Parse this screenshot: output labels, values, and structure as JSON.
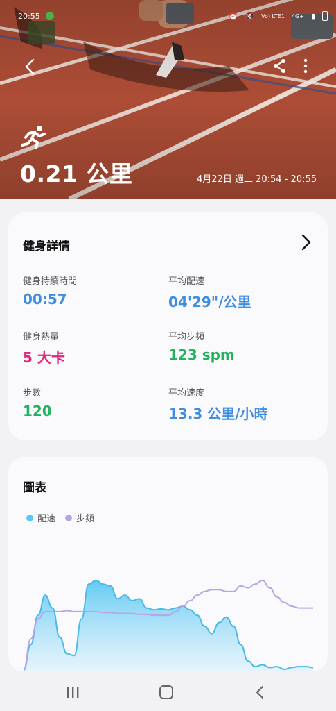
{
  "status_bar": {
    "time": "20:55",
    "signal_text": "Vo) LTE1",
    "network_text": "4G+"
  },
  "hero": {
    "distance": "0.21 公里",
    "datetime": "4月22日 週二 20:54 - 20:55",
    "icons": {
      "back": "back-arrow-icon",
      "share": "share-icon",
      "more": "more-vertical-icon",
      "activity": "running-icon"
    }
  },
  "details": {
    "title": "健身詳情",
    "metrics": [
      {
        "label": "健身持續時間",
        "value": "00:57",
        "color": "#3f8de0"
      },
      {
        "label": "平均配速",
        "value": "04'29\"/公里",
        "color": "#3f8de0"
      },
      {
        "label": "健身熱量",
        "value": "5 大卡",
        "color": "#e0267a"
      },
      {
        "label": "平均步頻",
        "value": "123 spm",
        "color": "#23b35e"
      },
      {
        "label": "步數",
        "value": "120",
        "color": "#23b35e"
      },
      {
        "label": "平均速度",
        "value": "13.3 公里/小時",
        "color": "#3f8de0"
      }
    ]
  },
  "chart": {
    "title": "圖表",
    "legend": [
      {
        "name": "配速",
        "color": "#5cc8f2"
      },
      {
        "name": "步頻",
        "color": "#b9a3e3"
      }
    ]
  },
  "chart_data": {
    "type": "area",
    "x": [
      0,
      1,
      2,
      3,
      4,
      5,
      6,
      7,
      8,
      9,
      10,
      11,
      12,
      13,
      14,
      15,
      16,
      17,
      18,
      19,
      20,
      21,
      22,
      23,
      24,
      25,
      26,
      27,
      28,
      29,
      30,
      31,
      32,
      33,
      34,
      35,
      36,
      37,
      38,
      39,
      40
    ],
    "series": [
      {
        "name": "配速",
        "values": [
          2,
          30,
          62,
          84,
          70,
          38,
          20,
          18,
          58,
          96,
          100,
          96,
          94,
          80,
          84,
          78,
          80,
          70,
          68,
          69,
          68,
          70,
          72,
          68,
          62,
          50,
          42,
          54,
          60,
          50,
          30,
          12,
          6,
          8,
          5,
          6,
          3,
          5,
          6,
          6,
          5
        ]
      },
      {
        "name": "步頻",
        "values": [
          2,
          36,
          58,
          66,
          66,
          66,
          67,
          66,
          66,
          66,
          66,
          65,
          65,
          64,
          64,
          64,
          63,
          63,
          62,
          62,
          62,
          66,
          72,
          78,
          84,
          88,
          90,
          90,
          88,
          88,
          94,
          92,
          96,
          100,
          92,
          82,
          76,
          72,
          70,
          70,
          70
        ]
      }
    ]
  },
  "navbar": {
    "icons": [
      "recent-apps-icon",
      "home-icon",
      "back-nav-icon"
    ]
  }
}
